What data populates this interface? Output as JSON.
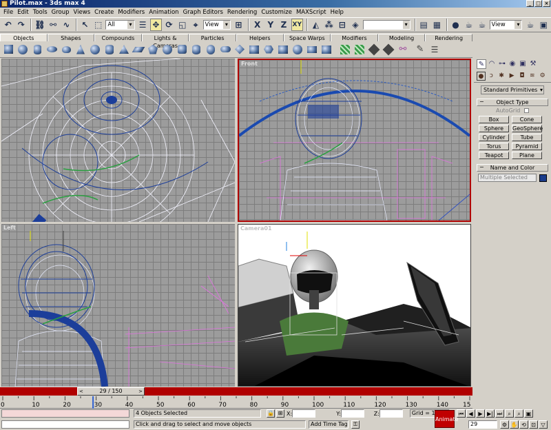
{
  "window": {
    "title": "Pilot.max - 3ds max 4",
    "min": "_",
    "max": "□",
    "close": "×"
  },
  "menu": [
    "File",
    "Edit",
    "Tools",
    "Group",
    "Views",
    "Create",
    "Modifiers",
    "Animation",
    "Graph Editors",
    "Rendering",
    "Customize",
    "MAXScript",
    "Help"
  ],
  "toolbar": {
    "selection_filter": "All",
    "ref_coord": "View",
    "axis_x": "X",
    "axis_y": "Y",
    "axis_z": "Z",
    "axis_xy": "XY",
    "named_sel": "",
    "render_type": "View"
  },
  "tabs": [
    "Objects",
    "Shapes",
    "Compounds",
    "Lights & Cameras",
    "Particles",
    "Helpers",
    "Space Warps",
    "Modifiers",
    "Modeling",
    "Rendering"
  ],
  "active_tab": "Objects",
  "viewports": {
    "top": "",
    "front": "Front",
    "left": "Left",
    "camera": "Camera01"
  },
  "command_panel": {
    "category": "Standard Primitives",
    "object_type_header": "Object Type",
    "autogrid": "AutoGrid",
    "buttons": [
      "Box",
      "Cone",
      "Sphere",
      "GeoSphere",
      "Cylinder",
      "Tube",
      "Torus",
      "Pyramid",
      "Teapot",
      "Plane"
    ],
    "name_color_header": "Name and Color",
    "name_value": "Multiple Selected",
    "object_color": "#1a3b8a"
  },
  "timeline": {
    "slider": "29 / 150",
    "prev": "<",
    "next": ">",
    "ticks": [
      "0",
      "10",
      "20",
      "30",
      "40",
      "50",
      "60",
      "70",
      "80",
      "90",
      "100",
      "110",
      "120",
      "130",
      "140",
      "15"
    ],
    "current_frame": 29,
    "total_frames": 150
  },
  "status": {
    "selection": "4 Objects Selected",
    "prompt": "Click and drag to select and move objects",
    "x_label": "X:",
    "y_label": "Y:",
    "z_label": "Z:",
    "x_value": "",
    "y_value": "",
    "z_value": "",
    "grid": "Grid = 10.0",
    "add_time_tag": "Add Time Tag",
    "animate": "Animate",
    "frame": "29"
  },
  "colors": {
    "active_viewport_border": "#b00000",
    "animate": "#c00000"
  }
}
